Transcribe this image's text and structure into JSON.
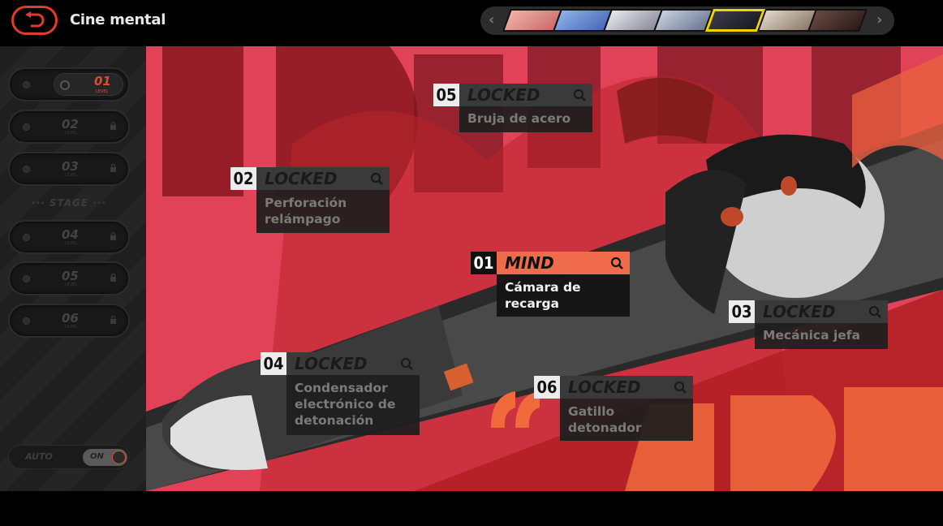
{
  "header": {
    "title": "Cine mental"
  },
  "portraits": [
    {
      "name": "portrait-1",
      "color": "#f3b2a6",
      "selected": false
    },
    {
      "name": "portrait-2",
      "color": "#8fb0e8",
      "selected": false
    },
    {
      "name": "portrait-3",
      "color": "#d8d8e2",
      "selected": false
    },
    {
      "name": "portrait-4",
      "color": "#b7c0d2",
      "selected": false
    },
    {
      "name": "portrait-5",
      "color": "#2a2a36",
      "selected": true
    },
    {
      "name": "portrait-6",
      "color": "#d6cbc0",
      "selected": false
    },
    {
      "name": "portrait-7",
      "color": "#5a3a34",
      "selected": false
    }
  ],
  "sidebar": {
    "levels": [
      {
        "num": "01",
        "sub": "LEVEL",
        "active": true
      },
      {
        "num": "02",
        "sub": "LEVEL",
        "active": false
      },
      {
        "num": "03",
        "sub": "LEVEL",
        "active": false
      },
      {
        "num": "04",
        "sub": "LEVEL",
        "active": false
      },
      {
        "num": "05",
        "sub": "LEVEL",
        "active": false
      },
      {
        "num": "06",
        "sub": "LEVEL",
        "active": false
      }
    ],
    "stage_label": "STAGE",
    "auto_label": "AUTO",
    "auto_state": "ON"
  },
  "cards": [
    {
      "num": "05",
      "state": "LOCKED",
      "title": "Bruja de acero"
    },
    {
      "num": "02",
      "state": "LOCKED",
      "title": "Perforación relámpago"
    },
    {
      "num": "01",
      "state": "MIND",
      "title": "Cámara de recarga"
    },
    {
      "num": "03",
      "state": "LOCKED",
      "title": "Mecánica jefa"
    },
    {
      "num": "04",
      "state": "LOCKED",
      "title": "Condensador electrónico de detonación"
    },
    {
      "num": "06",
      "state": "LOCKED",
      "title": "Gatillo detonador"
    }
  ],
  "colors": {
    "accent": "#f06a4c",
    "back": "#e23a2c",
    "selected_portrait": "#f0d400"
  }
}
